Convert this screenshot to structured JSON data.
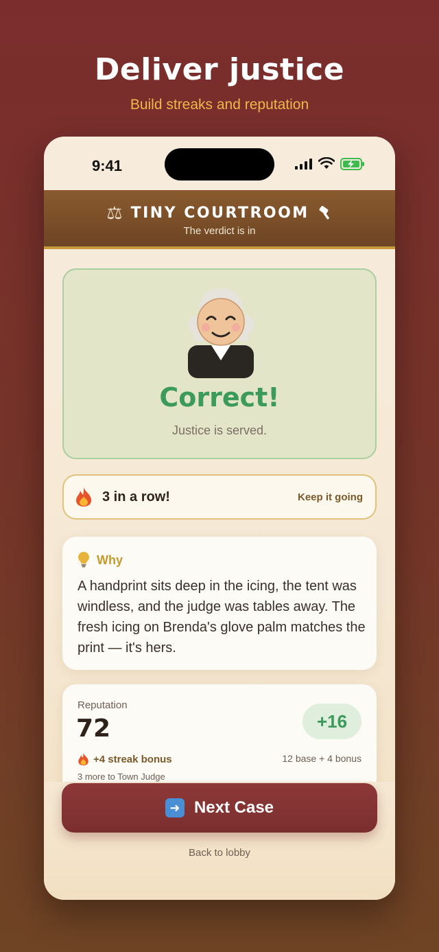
{
  "promo": {
    "title": "Deliver justice",
    "subtitle": "Build streaks and reputation"
  },
  "status_bar": {
    "time": "9:41"
  },
  "header": {
    "app_name": "TINY COURTROOM",
    "tagline": "The verdict is in"
  },
  "result": {
    "title": "Correct!",
    "subtitle": "Justice is served.",
    "accent_color": "#3c9a5a"
  },
  "streak": {
    "label": "3 in a row!",
    "cta": "Keep it going"
  },
  "why": {
    "title": "Why",
    "text": "A handprint sits deep in the icing, the tent was windless, and the judge was tables away. The fresh icing on Brenda's glove palm matches the print — it's hers."
  },
  "reputation": {
    "label": "Reputation",
    "value": "72",
    "delta": "+16",
    "streak_bonus": "+4 streak bonus",
    "breakdown": "12 base + 4 bonus",
    "next_rank": "3 more to Town Judge"
  },
  "actions": {
    "next_label": "Next Case",
    "back_label": "Back to lobby",
    "button_color": "#7a2e2e"
  },
  "icons": {
    "scales": "⚖"
  }
}
